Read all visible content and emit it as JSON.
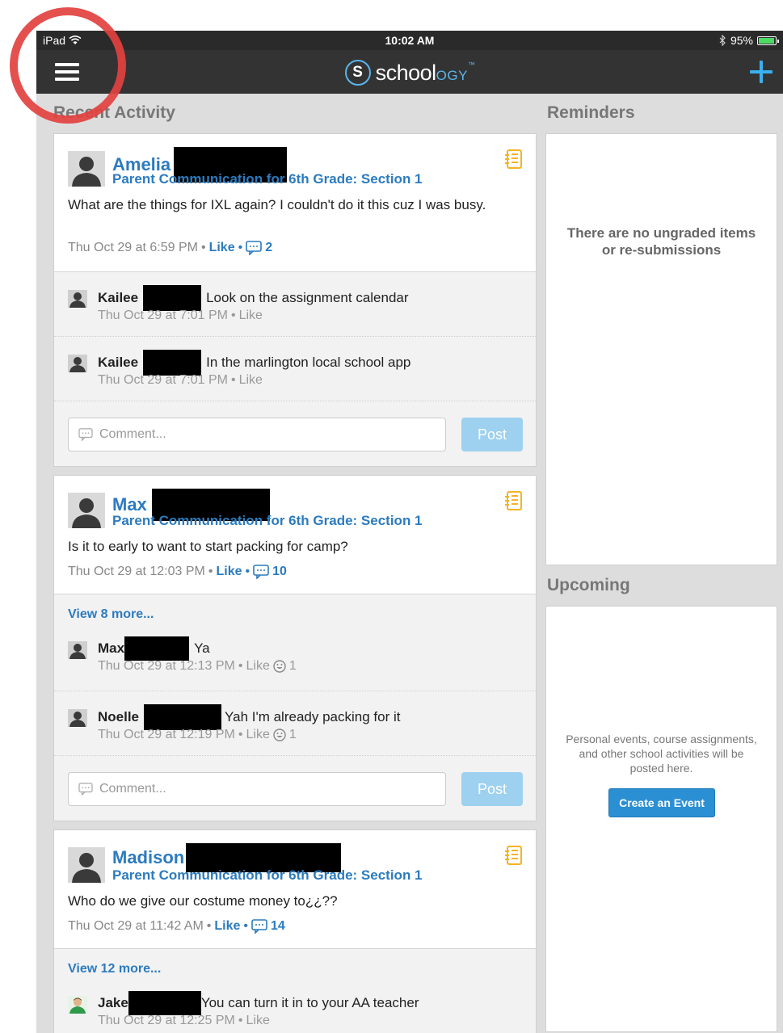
{
  "status_bar": {
    "device": "iPad",
    "time": "10:02 AM",
    "battery": "95%",
    "battery_level": 0.95
  },
  "app": {
    "logo_letter": "S",
    "logo_word": "school",
    "logo_suffix": "OGY",
    "logo_mark": "™"
  },
  "sections": {
    "recent_activity": "Recent Activity",
    "reminders": "Reminders",
    "upcoming": "Upcoming"
  },
  "posts": [
    {
      "author": "Amelia",
      "group": "Parent Communication for 6th Grade: Section 1",
      "body": "What are the things for IXL again? I couldn't do it this cuz I was busy.",
      "time": "Thu Oct 29 at 6:59 PM",
      "like": "Like",
      "comment_count": "2",
      "comments": [
        {
          "name": "Kailee",
          "text": "Look on the assignment calendar",
          "time": "Thu Oct 29 at 7:01 PM",
          "like": "Like"
        },
        {
          "name": "Kailee",
          "text": "In the marlington local school app",
          "time": "Thu Oct 29 at 7:01 PM",
          "like": "Like"
        }
      ],
      "comment_placeholder": "Comment...",
      "post_label": "Post"
    },
    {
      "author": "Max",
      "group": "Parent Communication for 6th Grade: Section 1",
      "body": "Is it to early to want to start packing for camp?",
      "time": "Thu Oct 29 at 12:03 PM",
      "like": "Like",
      "comment_count": "10",
      "view_more": "View 8 more...",
      "comments": [
        {
          "name": "Max",
          "text": "Ya",
          "time": "Thu Oct 29 at 12:13 PM",
          "like": "Like",
          "reactions": "1"
        },
        {
          "name": "Noelle",
          "text": "Yah I'm already packing for it",
          "time": "Thu Oct 29 at 12:19 PM",
          "like": "Like",
          "reactions": "1"
        }
      ],
      "comment_placeholder": "Comment...",
      "post_label": "Post"
    },
    {
      "author": "Madison",
      "group": "Parent Communication for 6th Grade: Section 1",
      "body": "Who do we give our costume money to¿¿??",
      "time": "Thu Oct 29 at 11:42 AM",
      "like": "Like",
      "comment_count": "14",
      "view_more": "View 12 more...",
      "comments": [
        {
          "name": "Jake",
          "text": "You can turn it in to your AA teacher",
          "time": "Thu Oct 29 at 12:25 PM",
          "like": "Like"
        }
      ]
    }
  ],
  "reminders": {
    "empty_text": "There are no ungraded items or re-submissions"
  },
  "upcoming": {
    "empty_text": "Personal events, course assignments, and other school activities will be posted here.",
    "create_event": "Create an Event"
  },
  "colors": {
    "link_blue": "#2c7bbf",
    "nav_dark": "#333333",
    "accent": "#3bb0f0",
    "post_button": "#9dd1ef",
    "create_event": "#2b8fd4",
    "annotation": "#e2413f"
  }
}
